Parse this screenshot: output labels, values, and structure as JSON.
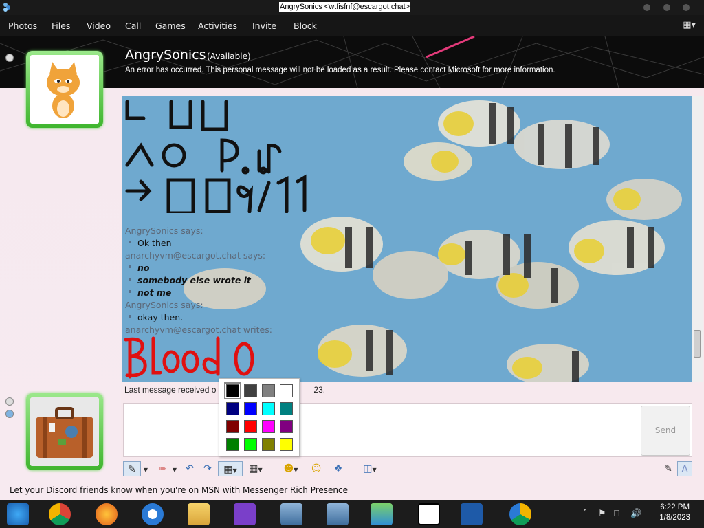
{
  "window": {
    "title": "AngrySonics <wtfisfnf@escargot.chat>"
  },
  "menu": [
    "Photos",
    "Files",
    "Video",
    "Call",
    "Games",
    "Activities",
    "Invite",
    "Block"
  ],
  "contact": {
    "display_name": "AngrySonics",
    "presence": "(Available)",
    "personal_message": "An error has occurred. This personal message will not be loaded as a result. Please contact Microsoft for more information."
  },
  "conversation": {
    "drawing_top_text": "□ □□\n∧o  P.I.r\n→□□9/11",
    "messages": [
      {
        "sender": "AngrySonics says:",
        "lines": [
          "Ok then"
        ],
        "style": "normal"
      },
      {
        "sender": "anarchyvm@escargot.chat says:",
        "lines": [
          "no",
          "somebody else wrote it",
          "not me"
        ],
        "style": "bold-italic"
      },
      {
        "sender": "AngrySonics says:",
        "lines": [
          "okay then."
        ],
        "style": "normal"
      },
      {
        "sender": "anarchyvm@escargot.chat writes:",
        "lines": [],
        "style": "ink"
      }
    ],
    "ink_text": "Blood O",
    "last_message_prefix": "Last message received o",
    "last_message_suffix": "23."
  },
  "color_palette": {
    "colors": [
      "#000000",
      "#404040",
      "#808080",
      "#ffffff",
      "#000080",
      "#0000ff",
      "#00ffff",
      "#008080",
      "#800000",
      "#ff0000",
      "#ff00ff",
      "#800080",
      "#008000",
      "#00ff00",
      "#808000",
      "#ffff00"
    ],
    "selected_index": 0
  },
  "input": {
    "send_label": "Send"
  },
  "toolbar": {
    "icons": [
      "pen-icon",
      "eraser-icon",
      "undo-icon",
      "redo-icon",
      "color-grid-icon",
      "background-grid-icon",
      "emoticon-icon",
      "wink-icon",
      "nudge-icon",
      "background-icon",
      "font-icon",
      "text-style-icon"
    ]
  },
  "ad_text": "Let your Discord friends know when you're on MSN with Messenger Rich Presence",
  "taskbar": {
    "time": "6:22 PM",
    "date": "1/8/2023",
    "apps": [
      "start-icon",
      "chrome-icon",
      "firefox-icon",
      "msn-icon",
      "file-explorer-icon",
      "visual-studio-icon",
      "network-app-icon",
      "network-app-2-icon",
      "people-app-icon",
      "7zip-icon",
      "powershell-icon",
      "chrome-canary-icon"
    ]
  }
}
